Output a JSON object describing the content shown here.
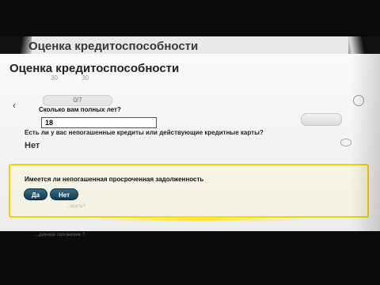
{
  "window": {
    "title_top": "Оценка кредитоспособности",
    "title_main": "Оценка кредитоспособности"
  },
  "ghost": {
    "row_items": [
      "30",
      "30"
    ],
    "pill": "0/7",
    "faint_line": "",
    "faint_question": "...ность?",
    "faint_bottom": "...дежное положение ?"
  },
  "form": {
    "age_label": "Сколько вам полных лет?",
    "age_value": "18",
    "loans_question": "Есть ли у вас непогашенные кредиты или действующие кредитные карты?",
    "loans_answer": "Нет",
    "overdue_question": "Имеется ли непогашенная просроченная задолженность",
    "yes_label": "Да",
    "no_label": "Нет"
  },
  "colors": {
    "highlight": "#f0d000",
    "button": "#1b4d63"
  }
}
